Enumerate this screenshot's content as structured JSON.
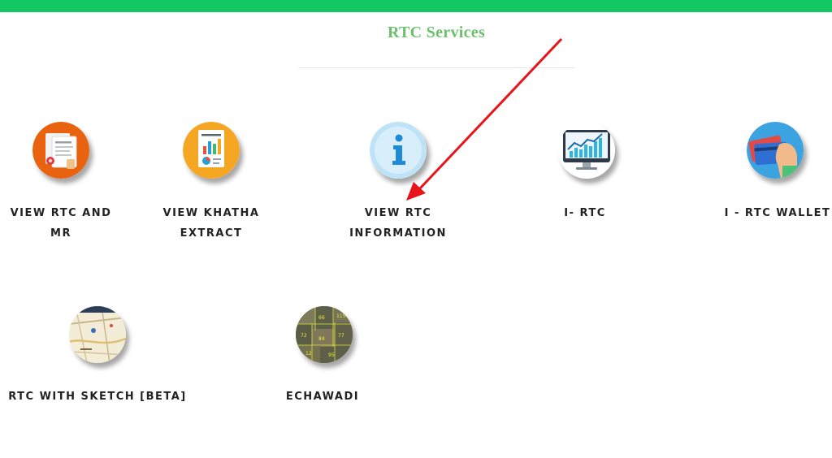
{
  "page": {
    "title": "RTC Services",
    "accent_color": "#12c865",
    "title_color": "#6dc06c"
  },
  "services": [
    {
      "label": "VIEW RTC AND MR",
      "icon": "document-certificate-icon"
    },
    {
      "label": "VIEW KHATHA EXTRACT",
      "icon": "report-chart-icon"
    },
    {
      "label": "VIEW RTC INFORMATION",
      "icon": "info-icon"
    },
    {
      "label": "I- RTC",
      "icon": "monitor-chart-icon"
    },
    {
      "label": "I - RTC WALLET",
      "icon": "wallet-cards-icon"
    },
    {
      "label": "RTC WITH SKETCH [BETA]",
      "icon": "map-sketch-icon"
    },
    {
      "label": "ECHAWADI",
      "icon": "land-survey-map-icon"
    }
  ],
  "annotation": {
    "type": "red-arrow",
    "points_to": "VIEW RTC INFORMATION",
    "color": "#e8141a"
  }
}
